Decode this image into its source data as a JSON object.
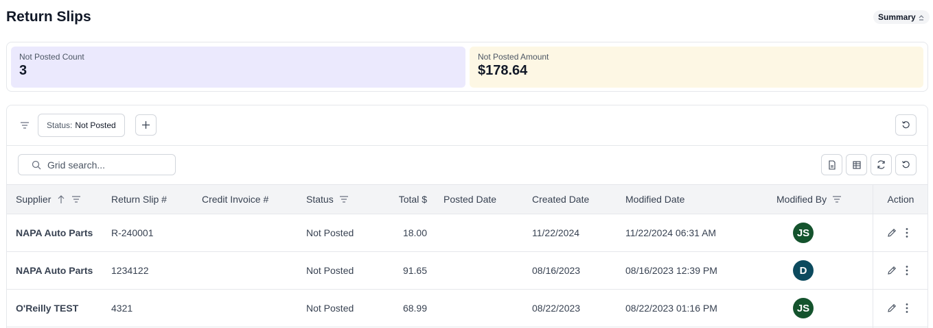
{
  "header": {
    "title": "Return Slips",
    "summary_label": "Summary"
  },
  "summary": {
    "cards": [
      {
        "label": "Not Posted Count",
        "value": "3",
        "color": "#ebe9fd"
      },
      {
        "label": "Not Posted Amount",
        "value": "$178.64",
        "color": "#fdf7e4"
      }
    ]
  },
  "filters": {
    "chip_key": "Status:",
    "chip_value": "Not Posted"
  },
  "toolbar": {
    "search_placeholder": "Grid search..."
  },
  "table": {
    "columns": [
      "Supplier",
      "Return Slip #",
      "Credit Invoice #",
      "Status",
      "Total $",
      "Posted Date",
      "Created Date",
      "Modified Date",
      "Modified By",
      "Action"
    ],
    "rows": [
      {
        "supplier": "NAPA Auto Parts",
        "slip": "R-240001",
        "credit_invoice": "",
        "status": "Not Posted",
        "total": "18.00",
        "posted_date": "",
        "created_date": "11/22/2024",
        "modified_date": "11/22/2024 06:31 AM",
        "modified_by": "JS",
        "avatar_color": "#14532d"
      },
      {
        "supplier": "NAPA Auto Parts",
        "slip": "1234122",
        "credit_invoice": "",
        "status": "Not Posted",
        "total": "91.65",
        "posted_date": "",
        "created_date": "08/16/2023",
        "modified_date": "08/16/2023 12:39 PM",
        "modified_by": "D",
        "avatar_color": "#0c4a5e"
      },
      {
        "supplier": "O'Reilly TEST",
        "slip": "4321",
        "credit_invoice": "",
        "status": "Not Posted",
        "total": "68.99",
        "posted_date": "",
        "created_date": "08/22/2023",
        "modified_date": "08/22/2023 01:16 PM",
        "modified_by": "JS",
        "avatar_color": "#14532d"
      }
    ]
  }
}
